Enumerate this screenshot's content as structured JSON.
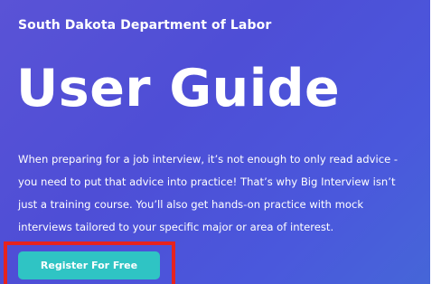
{
  "header": {
    "org_name": "South Dakota Department of Labor",
    "title": "User Guide"
  },
  "intro": {
    "lines": [
      "When preparing for a job interview, it’s not enough to only read advice -",
      "you need to put that advice into practice! That’s why Big Interview isn’t",
      "just a training course. You’ll also get hands-on practice with mock",
      "interviews tailored to your specific major or area of interest."
    ]
  },
  "cta": {
    "label": "Register For Free"
  },
  "colors": {
    "hero_background": "#4f52d8",
    "button": "#2fc4c4",
    "highlight": "#e6231f"
  }
}
